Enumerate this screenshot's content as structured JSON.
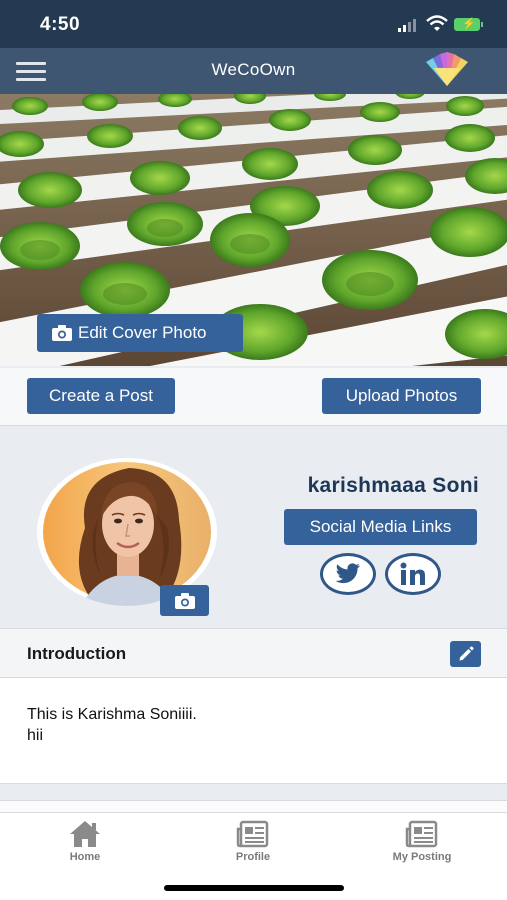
{
  "status_bar": {
    "time": "4:50"
  },
  "navbar": {
    "title": "WeCoOwn",
    "menu_icon": "hamburger-icon",
    "logo_icon": "wecoown-logo"
  },
  "cover": {
    "edit_label": "Edit Cover Photo",
    "camera_icon": "camera-icon"
  },
  "actions": {
    "create_post": "Create a Post",
    "upload_photos": "Upload Photos"
  },
  "profile": {
    "name": "karishmaaa Soni",
    "social_links_label": "Social Media Links",
    "social_icons": [
      "twitter-icon",
      "linkedin-icon"
    ]
  },
  "introduction": {
    "title": "Introduction",
    "line1": "This is Karishma Soniiii.",
    "line2": "hii",
    "edit_icon": "pencil-icon"
  },
  "tabs": [
    {
      "label": "Home",
      "icon": "home-icon"
    },
    {
      "label": "Profile",
      "icon": "newspaper-icon"
    },
    {
      "label": "My Posting",
      "icon": "newspaper-icon"
    }
  ],
  "colors": {
    "navbar": "#3e5672",
    "statusbar": "#243952",
    "button": "#36629b",
    "name": "#1d3756"
  }
}
